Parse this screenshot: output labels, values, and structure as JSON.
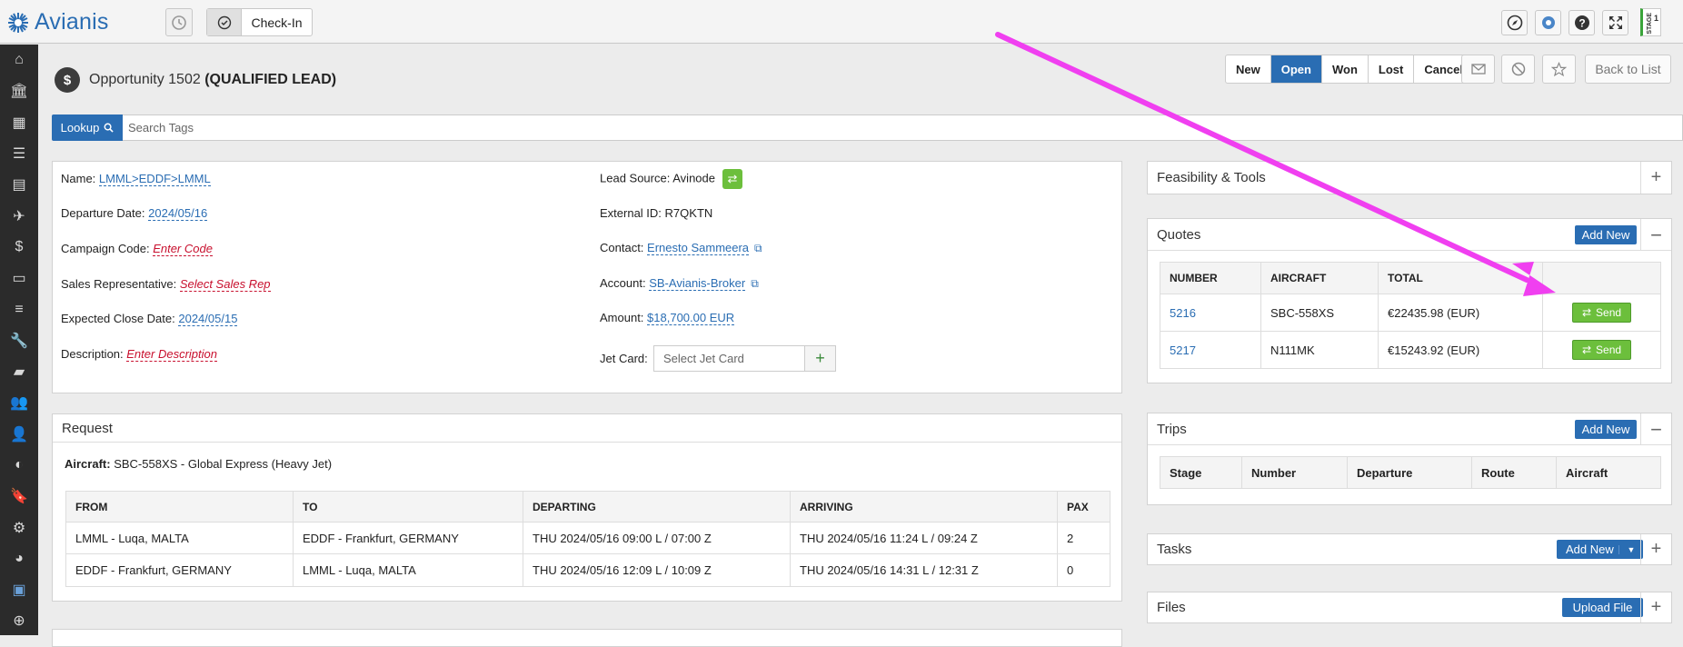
{
  "app": {
    "name": "Avianis"
  },
  "toolbar": {
    "checkin_label": "Check-In",
    "stage_label": "STAGE",
    "stage_number": "1"
  },
  "page": {
    "title_prefix": "Opportunity 1502",
    "title_status": "(QUALIFIED LEAD)"
  },
  "status_buttons": [
    "New",
    "Open",
    "Won",
    "Lost",
    "Cancel"
  ],
  "active_status": "Open",
  "back_label": "Back to List",
  "lookup": {
    "label": "Lookup",
    "placeholder": "Search Tags"
  },
  "details": {
    "name_label": "Name:",
    "name_value": "LMML>EDDF>LMML",
    "dep_label": "Departure Date:",
    "dep_value": "2024/05/16",
    "campaign_label": "Campaign Code:",
    "campaign_value": "Enter Code",
    "sales_label": "Sales Representative:",
    "sales_value": "Select Sales Rep",
    "close_label": "Expected Close Date:",
    "close_value": "2024/05/15",
    "desc_label": "Description:",
    "desc_value": "Enter Description",
    "lead_label": "Lead Source:",
    "lead_value": "Avinode",
    "ext_label": "External ID:",
    "ext_value": "R7QKTN",
    "contact_label": "Contact:",
    "contact_value": "Ernesto Sammeera",
    "account_label": "Account:",
    "account_value": "SB-Avianis-Broker",
    "amount_label": "Amount:",
    "amount_value": "$18,700.00 EUR",
    "jet_label": "Jet Card:",
    "jet_placeholder": "Select Jet Card"
  },
  "request": {
    "title": "Request",
    "aircraft_label": "Aircraft:",
    "aircraft_value": "SBC-558XS - Global Express (Heavy Jet)",
    "headers": [
      "FROM",
      "TO",
      "DEPARTING",
      "ARRIVING",
      "PAX"
    ],
    "rows": [
      [
        "LMML - Luqa, MALTA",
        "EDDF - Frankfurt, GERMANY",
        "THU 2024/05/16 09:00 L / 07:00 Z",
        "THU 2024/05/16 11:24 L / 09:24 Z",
        "2"
      ],
      [
        "EDDF - Frankfurt, GERMANY",
        "LMML - Luqa, MALTA",
        "THU 2024/05/16 12:09 L / 10:09 Z",
        "THU 2024/05/16 14:31 L / 12:31 Z",
        "0"
      ]
    ]
  },
  "feasibility": {
    "title": "Feasibility & Tools"
  },
  "quotes": {
    "title": "Quotes",
    "add_label": "Add New",
    "headers": [
      "NUMBER",
      "AIRCRAFT",
      "TOTAL"
    ],
    "rows": [
      {
        "number": "5216",
        "aircraft": "SBC-558XS",
        "total": "€22435.98 (EUR)",
        "send": "Send"
      },
      {
        "number": "5217",
        "aircraft": "N111MK",
        "total": "€15243.92 (EUR)",
        "send": "Send"
      }
    ]
  },
  "trips": {
    "title": "Trips",
    "add_label": "Add New",
    "headers": [
      "Stage",
      "Number",
      "Departure",
      "Route",
      "Aircraft"
    ]
  },
  "tasks": {
    "title": "Tasks",
    "add_label": "Add New"
  },
  "files": {
    "title": "Files",
    "upload_label": "Upload File"
  },
  "colors": {
    "accent": "#2a6db3",
    "send": "#6cbf3c",
    "annotation_arrow": "#f03ff0",
    "sidebar": "#2b2b2b"
  }
}
